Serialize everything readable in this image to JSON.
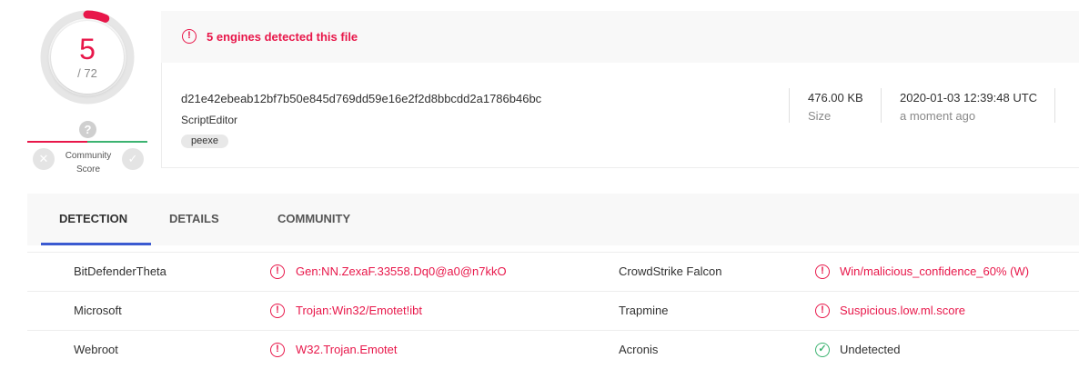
{
  "score": {
    "detections": "5",
    "total": "/ 72",
    "ratio": 0.069,
    "ring_color": "#e8174a"
  },
  "community": {
    "icon": "question-icon",
    "glyph": "?",
    "label_line1": "Community",
    "label_line2": "Score",
    "negative_icon": "close-icon",
    "positive_icon": "check-icon"
  },
  "alert": {
    "text": "5 engines detected this file",
    "icon": "alert-circle-icon",
    "color": "#e8174a"
  },
  "file": {
    "hash": "d21e42ebeab12bf7b50e845d769dd59e16e2f2d8bbcdd2a1786b46bc",
    "name": "ScriptEditor",
    "tag": "peexe",
    "size_value": "476.00 KB",
    "size_label": "Size",
    "date_value": "2020-01-03 12:39:48 UTC",
    "date_label": "a moment ago"
  },
  "tabs": [
    {
      "label": "DETECTION",
      "active": true
    },
    {
      "label": "DETAILS",
      "active": false
    },
    {
      "label": "COMMUNITY",
      "active": false
    }
  ],
  "detections": [
    {
      "left": {
        "engine": "BitDefenderTheta",
        "result": "Gen:NN.ZexaF.33558.Dq0@a0@n7kkO",
        "status": "malicious"
      },
      "right": {
        "engine": "CrowdStrike Falcon",
        "result": "Win/malicious_confidence_60% (W)",
        "status": "malicious"
      }
    },
    {
      "left": {
        "engine": "Microsoft",
        "result": "Trojan:Win32/Emotet!ibt",
        "status": "malicious"
      },
      "right": {
        "engine": "Trapmine",
        "result": "Suspicious.low.ml.score",
        "status": "malicious"
      }
    },
    {
      "left": {
        "engine": "Webroot",
        "result": "W32.Trojan.Emotet",
        "status": "malicious"
      },
      "right": {
        "engine": "Acronis",
        "result": "Undetected",
        "status": "undetected"
      }
    }
  ],
  "colors": {
    "malicious": "#e8174a",
    "undetected": "#3cb371",
    "accent": "#3b5ad1"
  }
}
